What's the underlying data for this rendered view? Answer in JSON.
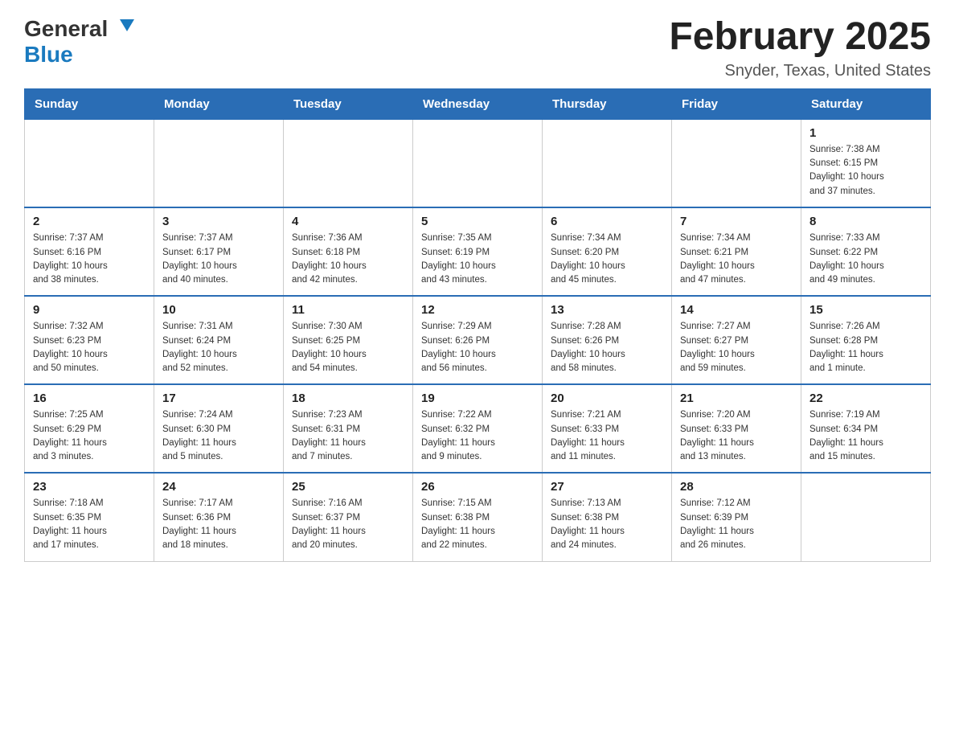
{
  "header": {
    "logo_general": "General",
    "logo_blue": "Blue",
    "month_title": "February 2025",
    "location": "Snyder, Texas, United States"
  },
  "weekdays": [
    "Sunday",
    "Monday",
    "Tuesday",
    "Wednesday",
    "Thursday",
    "Friday",
    "Saturday"
  ],
  "weeks": [
    [
      {
        "day": "",
        "info": ""
      },
      {
        "day": "",
        "info": ""
      },
      {
        "day": "",
        "info": ""
      },
      {
        "day": "",
        "info": ""
      },
      {
        "day": "",
        "info": ""
      },
      {
        "day": "",
        "info": ""
      },
      {
        "day": "1",
        "info": "Sunrise: 7:38 AM\nSunset: 6:15 PM\nDaylight: 10 hours\nand 37 minutes."
      }
    ],
    [
      {
        "day": "2",
        "info": "Sunrise: 7:37 AM\nSunset: 6:16 PM\nDaylight: 10 hours\nand 38 minutes."
      },
      {
        "day": "3",
        "info": "Sunrise: 7:37 AM\nSunset: 6:17 PM\nDaylight: 10 hours\nand 40 minutes."
      },
      {
        "day": "4",
        "info": "Sunrise: 7:36 AM\nSunset: 6:18 PM\nDaylight: 10 hours\nand 42 minutes."
      },
      {
        "day": "5",
        "info": "Sunrise: 7:35 AM\nSunset: 6:19 PM\nDaylight: 10 hours\nand 43 minutes."
      },
      {
        "day": "6",
        "info": "Sunrise: 7:34 AM\nSunset: 6:20 PM\nDaylight: 10 hours\nand 45 minutes."
      },
      {
        "day": "7",
        "info": "Sunrise: 7:34 AM\nSunset: 6:21 PM\nDaylight: 10 hours\nand 47 minutes."
      },
      {
        "day": "8",
        "info": "Sunrise: 7:33 AM\nSunset: 6:22 PM\nDaylight: 10 hours\nand 49 minutes."
      }
    ],
    [
      {
        "day": "9",
        "info": "Sunrise: 7:32 AM\nSunset: 6:23 PM\nDaylight: 10 hours\nand 50 minutes."
      },
      {
        "day": "10",
        "info": "Sunrise: 7:31 AM\nSunset: 6:24 PM\nDaylight: 10 hours\nand 52 minutes."
      },
      {
        "day": "11",
        "info": "Sunrise: 7:30 AM\nSunset: 6:25 PM\nDaylight: 10 hours\nand 54 minutes."
      },
      {
        "day": "12",
        "info": "Sunrise: 7:29 AM\nSunset: 6:26 PM\nDaylight: 10 hours\nand 56 minutes."
      },
      {
        "day": "13",
        "info": "Sunrise: 7:28 AM\nSunset: 6:26 PM\nDaylight: 10 hours\nand 58 minutes."
      },
      {
        "day": "14",
        "info": "Sunrise: 7:27 AM\nSunset: 6:27 PM\nDaylight: 10 hours\nand 59 minutes."
      },
      {
        "day": "15",
        "info": "Sunrise: 7:26 AM\nSunset: 6:28 PM\nDaylight: 11 hours\nand 1 minute."
      }
    ],
    [
      {
        "day": "16",
        "info": "Sunrise: 7:25 AM\nSunset: 6:29 PM\nDaylight: 11 hours\nand 3 minutes."
      },
      {
        "day": "17",
        "info": "Sunrise: 7:24 AM\nSunset: 6:30 PM\nDaylight: 11 hours\nand 5 minutes."
      },
      {
        "day": "18",
        "info": "Sunrise: 7:23 AM\nSunset: 6:31 PM\nDaylight: 11 hours\nand 7 minutes."
      },
      {
        "day": "19",
        "info": "Sunrise: 7:22 AM\nSunset: 6:32 PM\nDaylight: 11 hours\nand 9 minutes."
      },
      {
        "day": "20",
        "info": "Sunrise: 7:21 AM\nSunset: 6:33 PM\nDaylight: 11 hours\nand 11 minutes."
      },
      {
        "day": "21",
        "info": "Sunrise: 7:20 AM\nSunset: 6:33 PM\nDaylight: 11 hours\nand 13 minutes."
      },
      {
        "day": "22",
        "info": "Sunrise: 7:19 AM\nSunset: 6:34 PM\nDaylight: 11 hours\nand 15 minutes."
      }
    ],
    [
      {
        "day": "23",
        "info": "Sunrise: 7:18 AM\nSunset: 6:35 PM\nDaylight: 11 hours\nand 17 minutes."
      },
      {
        "day": "24",
        "info": "Sunrise: 7:17 AM\nSunset: 6:36 PM\nDaylight: 11 hours\nand 18 minutes."
      },
      {
        "day": "25",
        "info": "Sunrise: 7:16 AM\nSunset: 6:37 PM\nDaylight: 11 hours\nand 20 minutes."
      },
      {
        "day": "26",
        "info": "Sunrise: 7:15 AM\nSunset: 6:38 PM\nDaylight: 11 hours\nand 22 minutes."
      },
      {
        "day": "27",
        "info": "Sunrise: 7:13 AM\nSunset: 6:38 PM\nDaylight: 11 hours\nand 24 minutes."
      },
      {
        "day": "28",
        "info": "Sunrise: 7:12 AM\nSunset: 6:39 PM\nDaylight: 11 hours\nand 26 minutes."
      },
      {
        "day": "",
        "info": ""
      }
    ]
  ]
}
